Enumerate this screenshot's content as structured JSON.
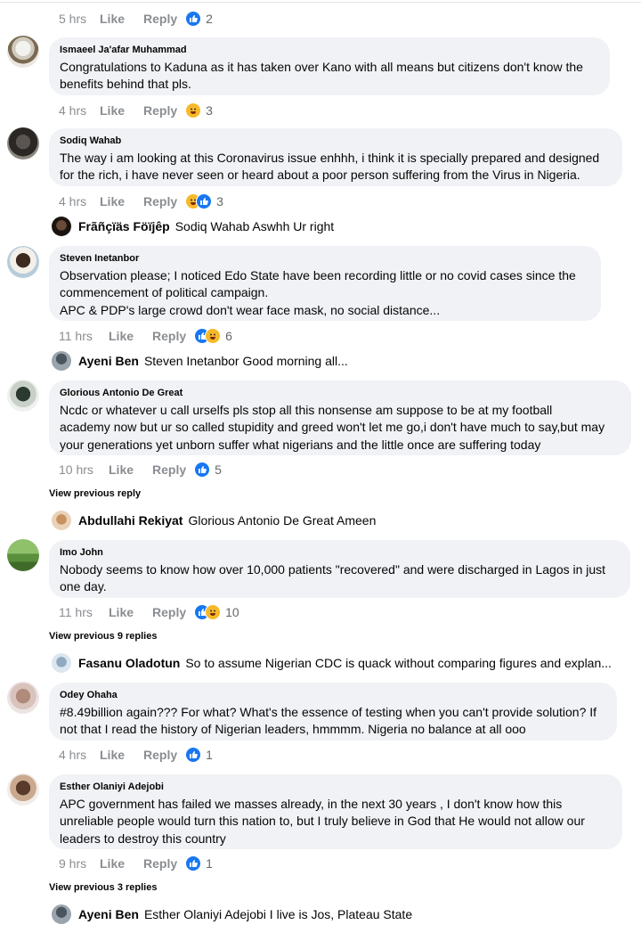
{
  "top_meta": {
    "time": "5 hrs",
    "like": "Like",
    "reply": "Reply",
    "reaction_count": "2",
    "reactions": [
      "like"
    ]
  },
  "comments": [
    {
      "author": "Ismaeel Ja'afar Muhammad",
      "text": "Congratulations to Kaduna as it has taken over Kano with all means but citizens don't know the\nbenefits behind that pls.",
      "time": "4 hrs",
      "like": "Like",
      "reply": "Reply",
      "reaction_count": "3",
      "reactions": [
        "haha"
      ]
    },
    {
      "author": "Sodiq Wahab",
      "text": "The way i am looking at this Coronavirus issue enhhh, i think it is specially prepared and designed\nfor the rich, i have never seen or heard about a poor person suffering from the Virus in Nigeria.",
      "time": "4 hrs",
      "like": "Like",
      "reply": "Reply",
      "reaction_count": "3",
      "reactions": [
        "haha",
        "like"
      ]
    },
    {
      "author": "Steven Inetanbor",
      "text": "Observation please; I noticed Edo State have been recording little or no covid cases since the\ncommencement of political campaign.\nAPC & PDP's large crowd don't wear face mask, no social distance...",
      "time": "11 hrs",
      "like": "Like",
      "reply": "Reply",
      "reaction_count": "6",
      "reactions": [
        "like",
        "haha"
      ]
    },
    {
      "author": "Glorious Antonio De Great",
      "text": "Ncdc or whatever u call urselfs pls stop all this nonsense am suppose to be at my football\nacademy now but ur so called stupidity and greed won't let me go,i don't have much to say,but may\nyour generations yet unborn suffer what nigerians and the little once are suffering today",
      "time": "10 hrs",
      "like": "Like",
      "reply": "Reply",
      "reaction_count": "5",
      "reactions": [
        "like"
      ]
    },
    {
      "author": "Imo John",
      "text": "Nobody seems to know how over 10,000 patients \"recovered\" and were discharged in Lagos in just\none day.",
      "time": "11 hrs",
      "like": "Like",
      "reply": "Reply",
      "reaction_count": "10",
      "reactions": [
        "like",
        "haha"
      ]
    },
    {
      "author": "Odey Ohaha",
      "text": "#8.49billion again??? For what? What's the essence of testing when you can't provide solution? If\nnot that I read the history of Nigerian leaders, hmmmm. Nigeria no balance at all ooo",
      "time": "4 hrs",
      "like": "Like",
      "reply": "Reply",
      "reaction_count": "1",
      "reactions": [
        "like"
      ]
    },
    {
      "author": "Esther Olaniyi Adejobi",
      "text": "APC government has failed we masses already, in the next 30 years , I don't know how this\nunreliable people would turn this  nation to, but I truly believe in God that He would   not allow our\nleaders to destroy this country",
      "time": "9 hrs",
      "like": "Like",
      "reply": "Reply",
      "reaction_count": "1",
      "reactions": [
        "like"
      ]
    }
  ],
  "replies": [
    {
      "name": "Frãñçïäs Föïjêp",
      "text": "Sodiq Wahab Aswhh Ur right"
    },
    {
      "name": "Ayeni Ben",
      "text": "Steven Inetanbor Good morning all..."
    },
    {
      "name": "Abdullahi Rekiyat",
      "text": "Glorious Antonio De Great Ameen"
    },
    {
      "name": "Fasanu Oladotun",
      "text": "So to assume Nigerian CDC is quack without comparing figures and explan..."
    },
    {
      "name": "Ayeni Ben",
      "text": "Esther Olaniyi Adejobi I live is Jos, Plateau State"
    }
  ],
  "view_previous": {
    "glorious": "View previous reply",
    "imo": "View previous 9 replies",
    "esther": "View previous 3 replies"
  },
  "colors": {
    "like_blue": "#1877f2",
    "haha_yellow": "#f7b928",
    "bubble_bg": "#f0f2f5",
    "meta_gray": "#8a8d91"
  }
}
